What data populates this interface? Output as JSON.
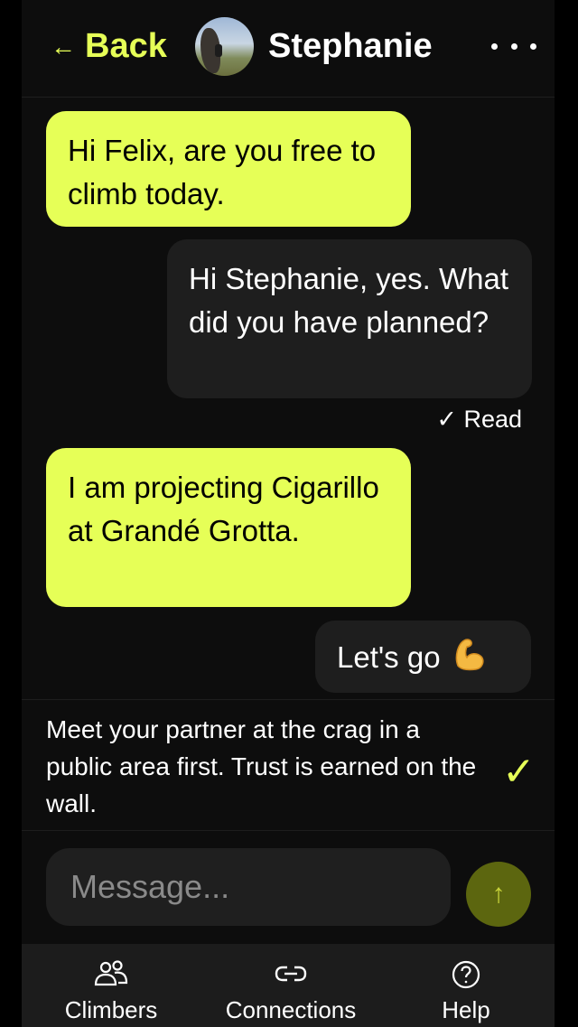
{
  "header": {
    "back_arrow": "←",
    "back_label": "Back",
    "contact_name": "Stephanie",
    "avatar_icon": "avatar-photo",
    "more_icon": "more-horizontal-icon"
  },
  "messages": [
    {
      "direction": "incoming",
      "text": "Hi Felix, are you free to climb today."
    },
    {
      "direction": "outgoing",
      "text": "Hi Stephanie, yes. What did you have planned?",
      "status": "✓ Read"
    },
    {
      "direction": "incoming",
      "text": "I am projecting Cigarillo at Grandé Grotta."
    },
    {
      "direction": "outgoing",
      "text": "Let's go",
      "emoji": "💪"
    }
  ],
  "safety_notice": {
    "text": "Meet your partner at the crag in a public area first. Trust is earned on the wall.",
    "check_glyph": "✓"
  },
  "composer": {
    "placeholder": "Message...",
    "send_glyph": "↑"
  },
  "nav": {
    "items": [
      {
        "label": "Climbers",
        "icon": "people-icon"
      },
      {
        "label": "Connections",
        "icon": "link-icon"
      },
      {
        "label": "Help",
        "icon": "help-icon"
      }
    ]
  },
  "colors": {
    "accent": "#e6ff57",
    "background": "#0d0d0d",
    "outgoing_bubble": "#1e1e1e",
    "send_button": "#5c660f"
  }
}
